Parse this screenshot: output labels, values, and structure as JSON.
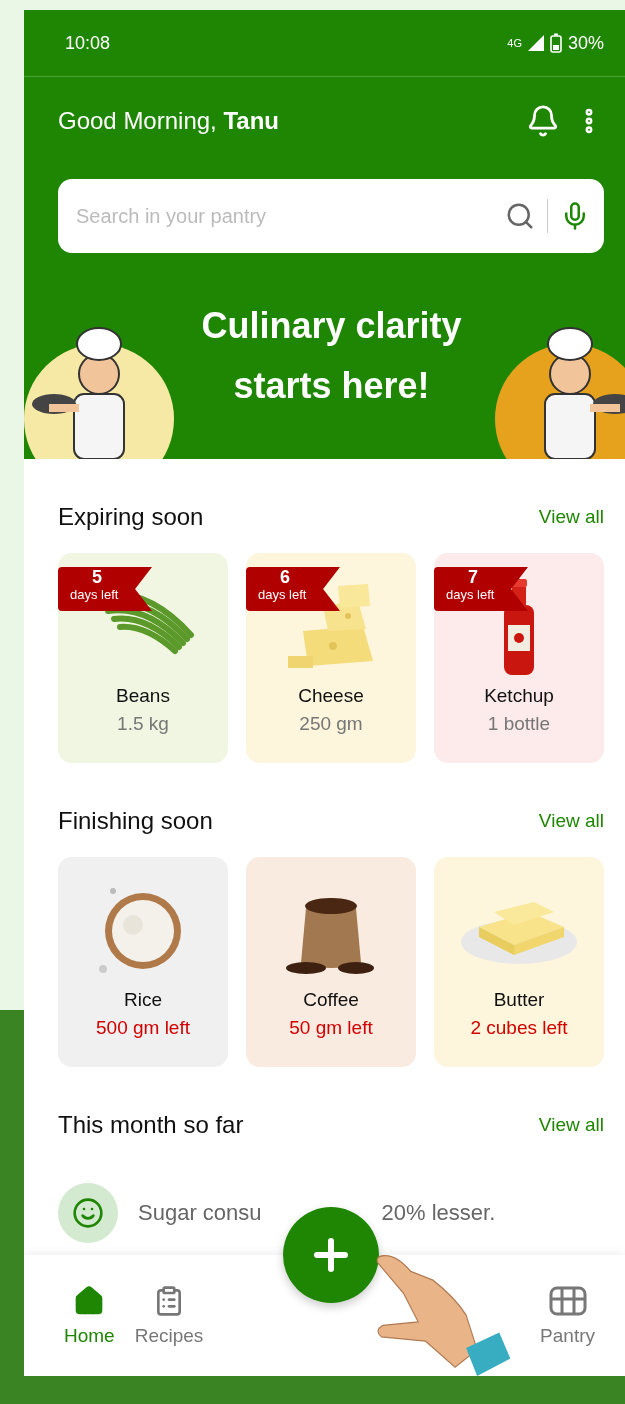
{
  "status_bar": {
    "time": "10:08",
    "network": "4G",
    "battery": "30%"
  },
  "header": {
    "greeting": "Good Morning, **Tanu**"
  },
  "search": {
    "placeholder": "Search in your pantry"
  },
  "banner": {
    "title": "Culinary clarity starts here!"
  },
  "expiring": {
    "title": "Expiring soon",
    "link": "View all",
    "items": [
      {
        "days": "5",
        "days_label": "days left",
        "name": "Beans",
        "amount": "1.5 kg",
        "color": "#f1f6e2",
        "kind": "beans"
      },
      {
        "days": "6",
        "days_label": "days left",
        "name": "Cheese",
        "amount": "250 gm",
        "color": "#fdf5dc",
        "kind": "cheese"
      },
      {
        "days": "7",
        "days_label": "days left",
        "name": "Ketchup",
        "amount": "1 bottle",
        "color": "#fdeaea",
        "kind": "ketchup"
      }
    ]
  },
  "finishing": {
    "title": "Finishing soon",
    "link": "View all",
    "items": [
      {
        "name": "Rice",
        "amount": "500 gm left",
        "color": "#f0f0f0",
        "kind": "rice"
      },
      {
        "name": "Coffee",
        "amount": "50 gm left",
        "color": "#f9ebe0",
        "kind": "coffee"
      },
      {
        "name": "Butter",
        "amount": "2 cubes left",
        "color": "#fdf5dc",
        "kind": "butter"
      }
    ]
  },
  "month": {
    "title": "This month so far",
    "link": "View all",
    "insight_fragments": [
      "Sugar consu",
      "20% lesser."
    ]
  },
  "nav": [
    {
      "label": "Home",
      "selected": true,
      "kind": "home"
    },
    {
      "label": "Recipes",
      "selected": false,
      "kind": "recipes"
    },
    {
      "label": "Pantry",
      "selected": false,
      "kind": "pantry"
    }
  ]
}
